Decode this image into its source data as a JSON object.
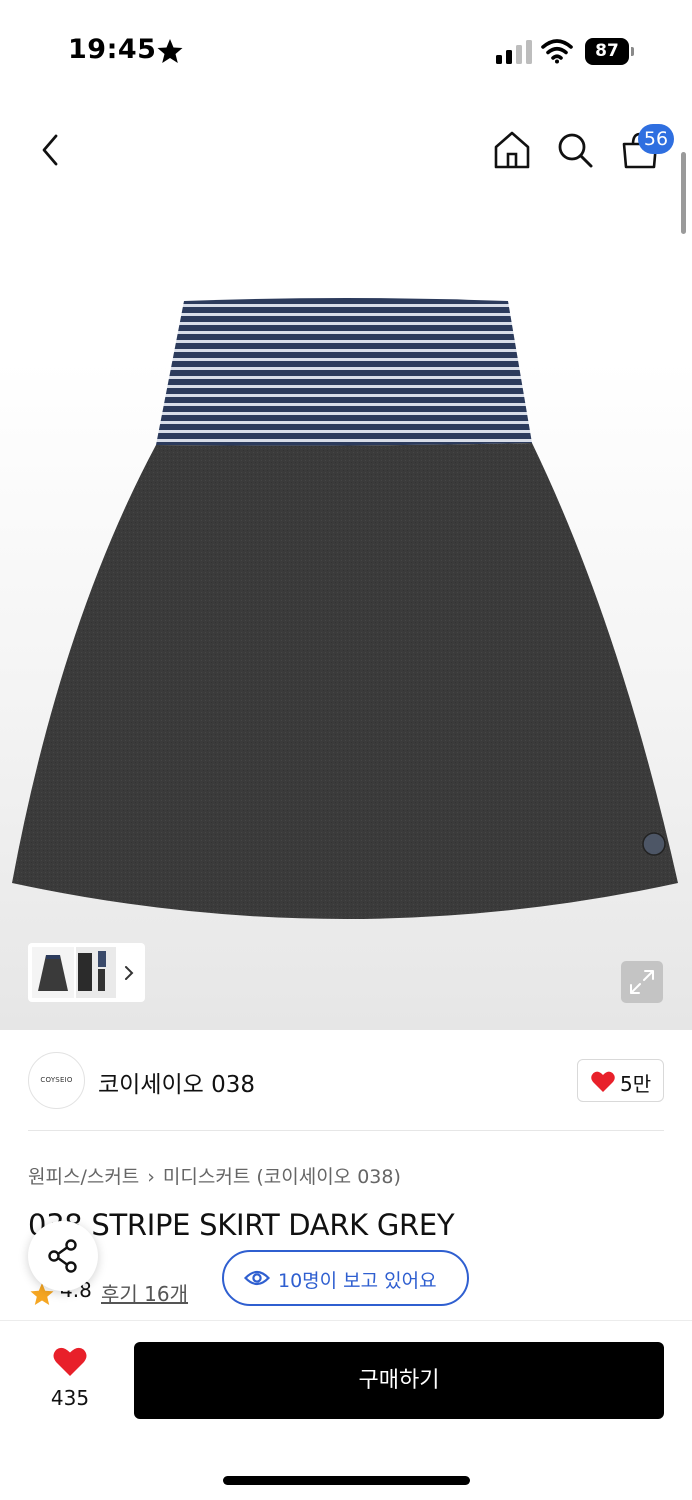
{
  "status_bar": {
    "time": "19:45",
    "battery": "87",
    "icons": [
      "star-icon",
      "signal-icon",
      "wifi-icon",
      "battery-icon"
    ]
  },
  "nav": {
    "icons": [
      "back-icon",
      "home-icon",
      "search-icon",
      "shopping-bag-icon"
    ],
    "cart_count": "56"
  },
  "gallery": {
    "expand_icon": "expand-icon",
    "thumbnail_arrow_icon": "chevron-right-icon"
  },
  "brand": {
    "logo_text": "COYSEIO",
    "name": "코이세이오 038",
    "like_count": "5만",
    "like_icon": "heart-icon"
  },
  "product": {
    "breadcrumb": [
      "원피스/스커트",
      "미디스커트 (코이세이오 038)"
    ],
    "title": "038 STRIPE SKIRT DARK GREY",
    "rating": "4.8",
    "review_link": "후기 16개",
    "viewers": "10명이 보고 있어요"
  },
  "bottom_bar": {
    "wish_count": "435",
    "buy_label": "구매하기"
  },
  "colors": {
    "accent_blue": "#2f5fd0",
    "badge_blue": "#2f6fe0",
    "heart_red": "#e8202a",
    "star_orange": "#f5a623",
    "buy_button": "#000000"
  }
}
